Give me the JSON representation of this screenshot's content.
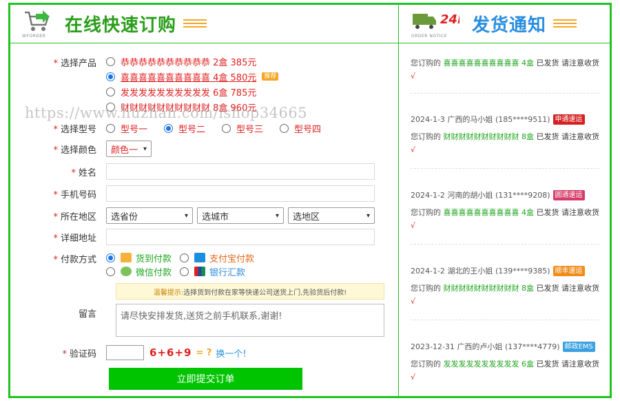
{
  "order_header": {
    "title": "在线快速订购",
    "logo_sub": "WFORDER"
  },
  "notice_header": {
    "title": "发货通知",
    "logo_sub": "ORDER NOTICE",
    "h24": "24h"
  },
  "form": {
    "product": {
      "label": "选择产品",
      "options": [
        {
          "text": "恭恭恭恭恭恭恭恭恭恭 2盒 385元",
          "selected": false
        },
        {
          "text": "喜喜喜喜喜喜喜喜喜喜 4盒 580元",
          "selected": true,
          "badge": "推荐"
        },
        {
          "text": "发发发发发发发发发发 6盒 785元",
          "selected": false
        },
        {
          "text": "财财财财财财财财财财 8盒 960元",
          "selected": false
        }
      ]
    },
    "model": {
      "label": "选择型号",
      "options": [
        {
          "text": "型号一",
          "selected": false
        },
        {
          "text": "型号二",
          "selected": true
        },
        {
          "text": "型号三",
          "selected": false
        },
        {
          "text": "型号四",
          "selected": false
        }
      ]
    },
    "color": {
      "label": "选择颜色",
      "value": "颜色一"
    },
    "name": {
      "label": "姓名"
    },
    "phone": {
      "label": "手机号码"
    },
    "region": {
      "label": "所在地区",
      "province": "选省份",
      "city": "选城市",
      "district": "选地区"
    },
    "address": {
      "label": "详细地址"
    },
    "payment": {
      "label": "付款方式",
      "options": [
        {
          "text": "货到付款",
          "selected": true,
          "color": "#1fa51f",
          "icon": "cash-on-delivery-icon"
        },
        {
          "text": "支付宝付款",
          "selected": false,
          "color": "#e0681a",
          "icon": "alipay-icon"
        },
        {
          "text": "微信付款",
          "selected": false,
          "color": "#1fa51f",
          "icon": "wechat-icon"
        },
        {
          "text": "银行汇款",
          "selected": false,
          "color": "#2a8ee0",
          "icon": "unionpay-icon"
        }
      ]
    },
    "tip": {
      "prefix": "温馨提示:",
      "text": "选择货到付款在家等快递公司送货上门,先验货后付款!"
    },
    "message": {
      "label": "留言",
      "value": "请尽快安排发货,送货之前手机联系,谢谢!"
    },
    "captcha": {
      "label": "验证码",
      "expr": "6+6+9",
      "eq": "= ?",
      "refresh": "换一个!"
    },
    "submit": "立即提交订单"
  },
  "watermark": "https://www.huzhan.com/ishop34665",
  "notices": [
    {
      "date": "",
      "region": "",
      "name": "",
      "phone": "",
      "carrier": "",
      "carrier_color": "",
      "prefix": "您订购的",
      "product": "喜喜喜喜喜喜喜喜喜喜 4盒",
      "status": "已发货 请注意收货",
      "check": "√"
    },
    {
      "date": "2024-1-3",
      "region": "广西的马小姐",
      "phone": "(185****9511)",
      "carrier": "申通速运",
      "carrier_color": "#d42020",
      "prefix": "您订购的",
      "product": "财财财财财财财财财财 8盒",
      "status": "已发货 请注意收货",
      "check": "√"
    },
    {
      "date": "2024-1-2",
      "region": "河南的胡小姐",
      "phone": "(131****9208)",
      "carrier": "圆通速运",
      "carrier_color": "#d63c6a",
      "prefix": "您订购的",
      "product": "喜喜喜喜喜喜喜喜喜喜 4盒",
      "status": "已发货 请注意收货",
      "check": "√"
    },
    {
      "date": "2024-1-2",
      "region": "湖北的王小姐",
      "phone": "(139****9385)",
      "carrier": "顺丰速运",
      "carrier_color": "#f08c1a",
      "prefix": "您订购的",
      "product": "财财财财财财财财财财 8盒",
      "status": "已发货 请注意收货",
      "check": "√"
    },
    {
      "date": "2023-12-31",
      "region": "广西的卢小姐",
      "phone": "(137****4779)",
      "carrier": "邮政EMS",
      "carrier_color": "#3aa0e0",
      "prefix": "您订购的",
      "product": "发发发发发发发发发发 6盒",
      "status": "已发货 请注意收货",
      "check": "√"
    }
  ]
}
